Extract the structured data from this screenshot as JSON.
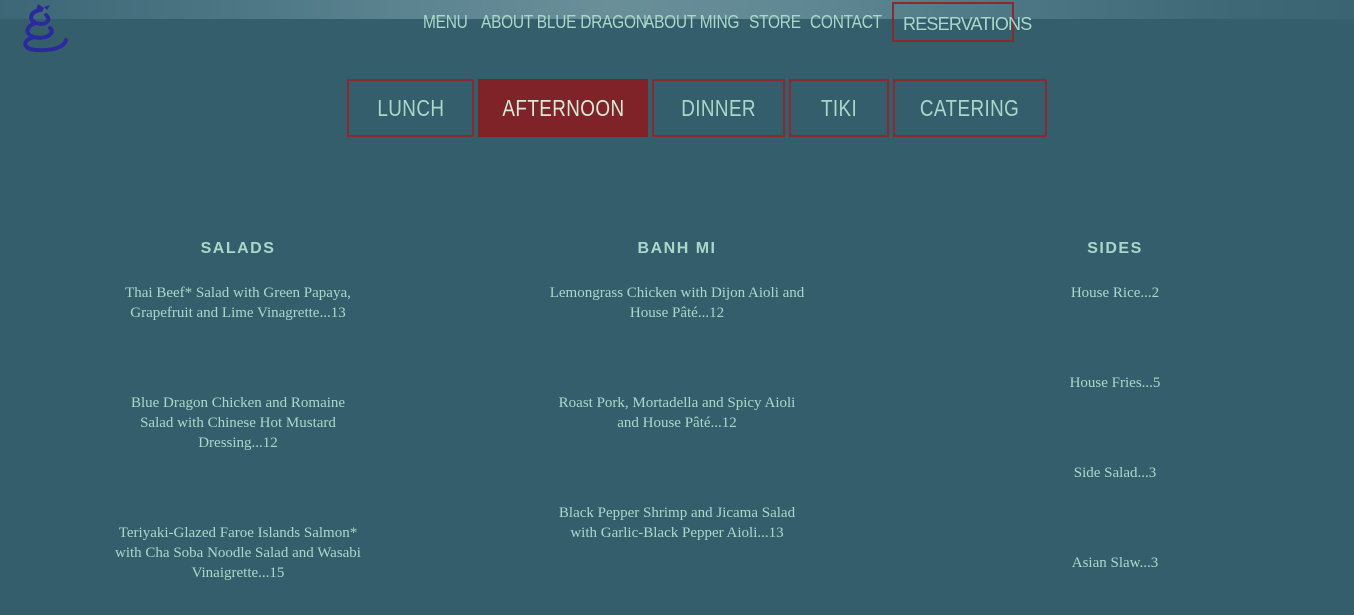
{
  "nav": {
    "items": [
      "MENU",
      "ABOUT BLUE DRAGON",
      "ABOUT MING",
      "STORE",
      "CONTACT"
    ],
    "reservations": "RESERVATIONS"
  },
  "tabs": [
    "LUNCH",
    "AFTERNOON",
    "DINNER",
    "TIKI",
    "CATERING"
  ],
  "active_tab": "AFTERNOON",
  "columns": [
    {
      "title": "SALADS",
      "items": [
        "Thai Beef* Salad with Green Papaya, Grapefruit and Lime Vinagrette...13",
        "Blue Dragon Chicken and Romaine Salad with Chinese Hot Mustard Dressing...12",
        "Teriyaki-Glazed Faroe Islands Salmon* with Cha Soba Noodle Salad and Wasabi Vinaigrette...15"
      ]
    },
    {
      "title": "BANH MI",
      "items": [
        "Lemongrass Chicken with Dijon Aioli and House Pâté...12",
        "Roast Pork, Mortadella and Spicy Aioli and House Pâté...12",
        "Black Pepper Shrimp and Jicama Salad with Garlic-Black Pepper Aioli...13"
      ]
    },
    {
      "title": "SIDES",
      "items": [
        "House Rice...2",
        "House Fries...5",
        "Side Salad...3",
        "Asian Slaw...3"
      ]
    }
  ],
  "colors": {
    "background": "#355e6c",
    "text": "#a9d8c9",
    "accent": "#7f2328",
    "logo": "#2b2a9c"
  },
  "icons": {
    "logo": "blue-dragon-logo-icon"
  }
}
